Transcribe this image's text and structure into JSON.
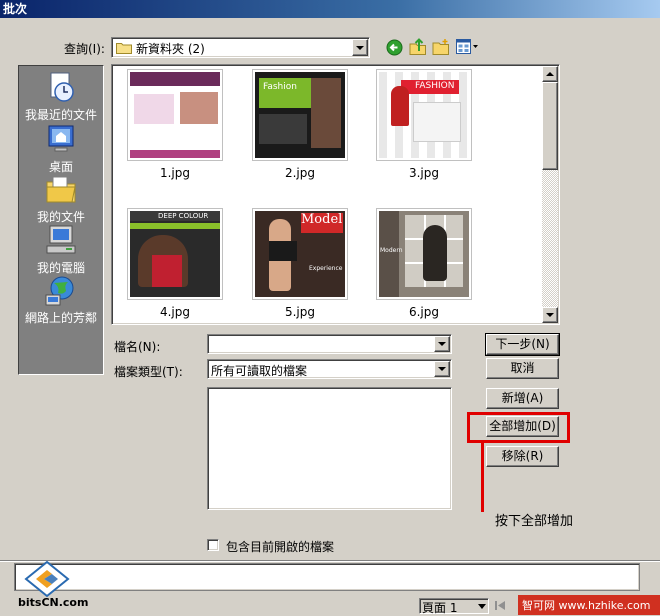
{
  "title": "批次",
  "lookin": {
    "label": "查詢(I):",
    "value": "新資料夾 (2)"
  },
  "toolbar": {
    "back_icon": "green-back-arrow-icon",
    "up_icon": "up-folder-icon",
    "newfolder_icon": "new-folder-icon",
    "view_icon": "view-menu-icon"
  },
  "places": [
    {
      "label": "我最近的文件",
      "icon": "recent-documents-icon"
    },
    {
      "label": "桌面",
      "icon": "desktop-icon"
    },
    {
      "label": "我的文件",
      "icon": "my-documents-icon"
    },
    {
      "label": "我的電腦",
      "icon": "my-computer-icon"
    },
    {
      "label": "網路上的芳鄰",
      "icon": "network-places-icon"
    }
  ],
  "files": [
    {
      "name": "1.jpg"
    },
    {
      "name": "2.jpg"
    },
    {
      "name": "3.jpg"
    },
    {
      "name": "4.jpg"
    },
    {
      "name": "5.jpg"
    },
    {
      "name": "6.jpg"
    }
  ],
  "thumb_text": {
    "t2": "Fashion",
    "t3": "FASHION",
    "t4": "DEEP COLOUR",
    "t5a": "Model",
    "t5b": "Experience",
    "t6": "Modern"
  },
  "form": {
    "filename_label": "檔名(N):",
    "filename_value": "",
    "filetype_label": "檔案類型(T):",
    "filetype_value": "所有可讀取的檔案",
    "include_open_label": "包含目前開啟的檔案"
  },
  "buttons": {
    "next": "下一步(N)",
    "cancel": "取消",
    "add": "新增(A)",
    "add_all": "全部增加(D)",
    "remove": "移除(R)"
  },
  "annotation": {
    "text": "按下全部增加",
    "color": "#e00000"
  },
  "statusbar": {
    "page": "頁面 1"
  },
  "watermark": {
    "logo_text": "bitsCN.com",
    "site_text": "智可网 www.hzhike.com"
  }
}
